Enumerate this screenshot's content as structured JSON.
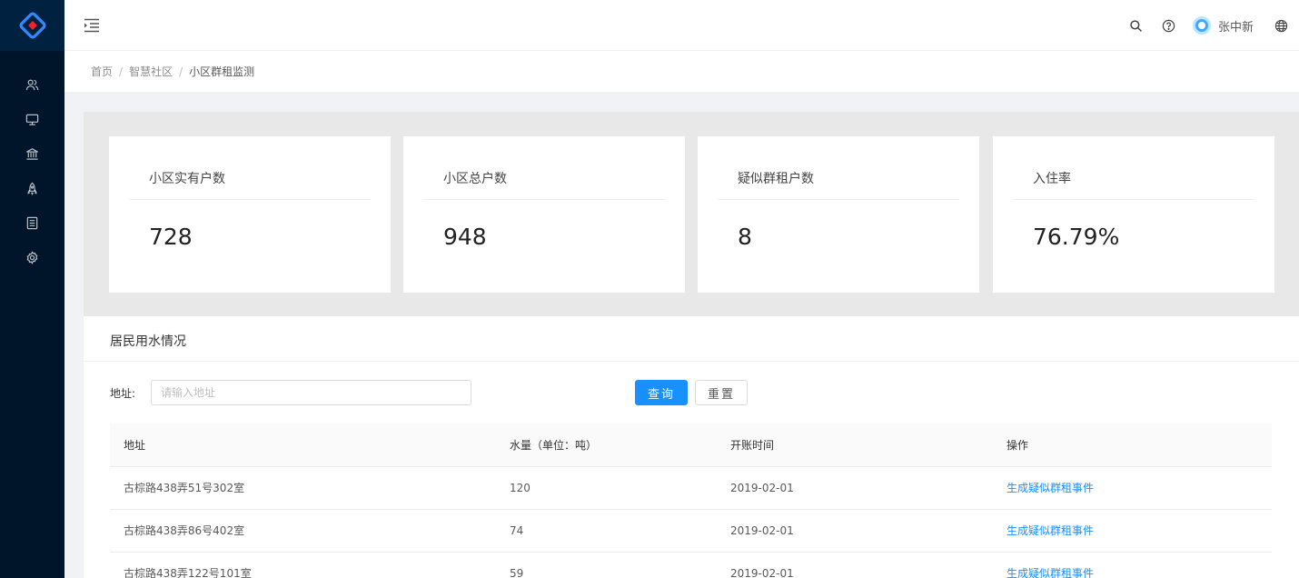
{
  "header": {
    "username": "张中新"
  },
  "breadcrumb": [
    "首页",
    "智慧社区",
    "小区群租监测"
  ],
  "stats": [
    {
      "title": "小区实有户数",
      "value": "728"
    },
    {
      "title": "小区总户数",
      "value": "948"
    },
    {
      "title": "疑似群租户数",
      "value": "8"
    },
    {
      "title": "入住率",
      "value": "76.79%"
    }
  ],
  "water": {
    "title": "居民用水情况",
    "filter": {
      "address_label": "地址:",
      "address_placeholder": "请输入地址",
      "address_value": "",
      "query_label": "查询",
      "reset_label": "重置"
    },
    "columns": [
      "地址",
      "水量（单位：吨）",
      "开账时间",
      "操作"
    ],
    "rows": [
      {
        "address": "古棕路438弄51号302室",
        "amount": "120",
        "date": "2019-02-01",
        "action": "生成疑似群租事件"
      },
      {
        "address": "古棕路438弄86号402室",
        "amount": "74",
        "date": "2019-02-01",
        "action": "生成疑似群租事件"
      },
      {
        "address": "古棕路438弄122号101室",
        "amount": "59",
        "date": "2019-02-01",
        "action": "生成疑似群租事件"
      }
    ]
  },
  "colors": {
    "sidebar": "#001529",
    "primary": "#1890ff",
    "logo_blue": "#2f8bff",
    "logo_red": "#f5222d"
  },
  "icons": {
    "sidebar": [
      "users-icon",
      "monitor-icon",
      "bank-icon",
      "rocket-icon",
      "profile-icon",
      "setting-icon"
    ],
    "header": [
      "menu-fold-icon",
      "search-icon",
      "question-icon",
      "global-icon"
    ]
  }
}
